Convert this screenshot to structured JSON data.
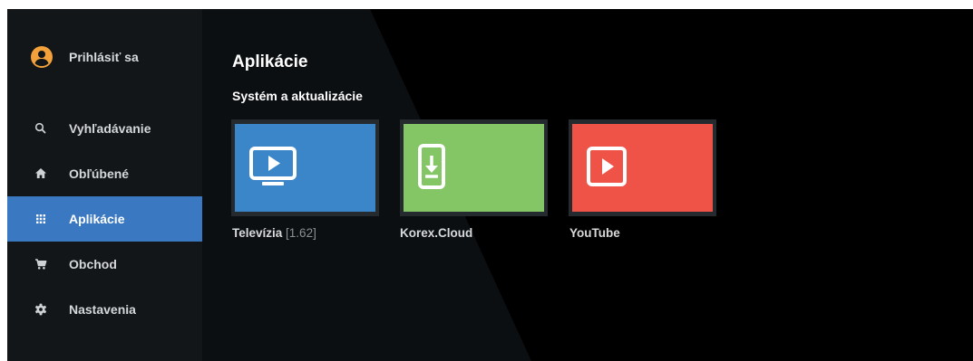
{
  "colors": {
    "sidebar_bg": "#121619",
    "active_item_bg": "#3a78c2",
    "avatar_accent": "#f2a13b",
    "tile_blue": "#3b86c9",
    "tile_green": "#84c565",
    "tile_red": "#ef5246"
  },
  "sidebar": {
    "user": {
      "label": "Prihlásiť sa",
      "icon": "account-circle-icon"
    },
    "items": [
      {
        "label": "Vyhľadávanie",
        "icon": "search-icon"
      },
      {
        "label": "Obľúbené",
        "icon": "home-icon"
      },
      {
        "label": "Aplikácie",
        "icon": "apps-grid-icon",
        "active": true
      },
      {
        "label": "Obchod",
        "icon": "shopping-cart-icon"
      },
      {
        "label": "Nastavenia",
        "icon": "settings-gear-icon"
      }
    ]
  },
  "main": {
    "title": "Aplikácie",
    "section": "Systém a aktualizácie",
    "apps": [
      {
        "name": "Televízia",
        "version": "[1.62]",
        "icon": "tv-play-icon"
      },
      {
        "name": "Korex.Cloud",
        "icon": "phone-download-icon"
      },
      {
        "name": "YouTube",
        "icon": "play-box-icon"
      }
    ]
  }
}
